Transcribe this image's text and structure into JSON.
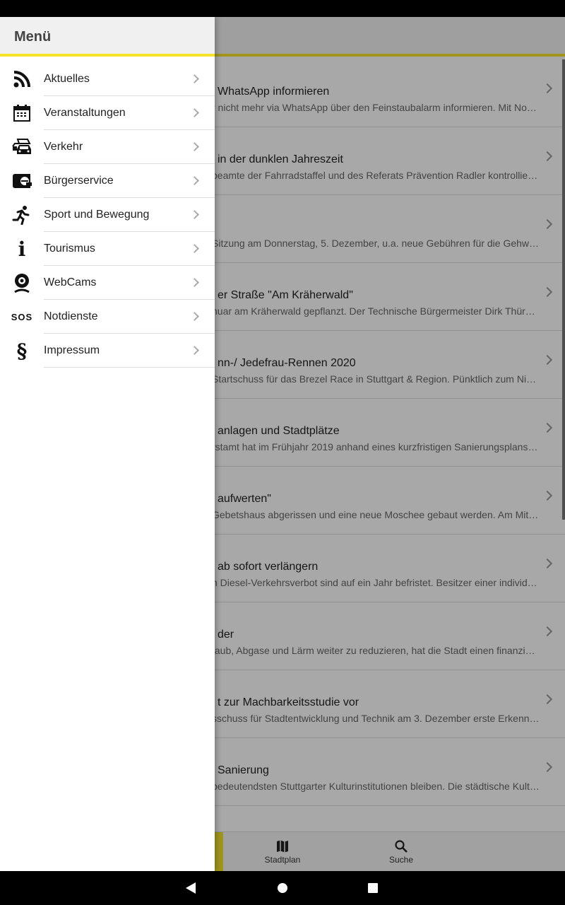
{
  "drawer": {
    "title": "Menü",
    "items": [
      {
        "label": "Aktuelles",
        "icon": "rss-icon"
      },
      {
        "label": "Veranstaltungen",
        "icon": "calendar-icon"
      },
      {
        "label": "Verkehr",
        "icon": "traffic-cars-icon"
      },
      {
        "label": "Bürgerservice",
        "icon": "e-service-icon"
      },
      {
        "label": "Sport und Bewegung",
        "icon": "running-icon"
      },
      {
        "label": "Tourismus",
        "icon": "info-icon",
        "glyph": "i"
      },
      {
        "label": "WebCams",
        "icon": "webcam-icon"
      },
      {
        "label": "Notdienste",
        "icon": "sos-icon",
        "glyph": "SOS"
      },
      {
        "label": "Impressum",
        "icon": "paragraph-icon",
        "glyph": "§"
      }
    ]
  },
  "news": [
    {
      "title": "WhatsApp informieren",
      "desc": "r nicht mehr via WhatsApp über den Feinstaubalarm informieren. Mit No…"
    },
    {
      "title": "in der dunklen Jahreszeit",
      "desc": "beamte der Fahrradstaffel und des Referats Prävention Radler kontrollier…"
    },
    {
      "title": "",
      "desc": "Sitzung am Donnerstag, 5. Dezember, u.a. neue Gebühren für die Gehweg…"
    },
    {
      "title": "er Straße \"Am Kräherwald\"",
      "desc": "nuar am Kräherwald gepflanzt. Der Technische Bürgermeister Dirk Thür…"
    },
    {
      "title": "nn-/ Jedefrau-Rennen 2020",
      "desc": "Startschuss für das Brezel Race in Stuttgart & Region. Pünktlich zum Nik…"
    },
    {
      "title": "anlagen und Stadtplätze",
      "desc": "rstamt hat im Frühjahr 2019 anhand eines kurzfristigen Sanierungsplans …"
    },
    {
      "title": "aufwerten\"",
      "desc": " Gebetshaus abgerissen und eine neue Moschee gebaut werden. Am Mit…"
    },
    {
      "title": "ab sofort verlängern",
      "desc": "n Diesel-Verkehrsverbot sind auf ein Jahr befristet. Besitzer einer individu…"
    },
    {
      "title": "der",
      "desc": "taub, Abgase und Lärm weiter zu reduzieren, hat die Stadt einen finanziel…"
    },
    {
      "title": "t zur Machbarkeitsstudie vor",
      "desc": "sschuss für Stadtentwicklung und Technik am 3. Dezember erste Erkennt…"
    },
    {
      "title": "Sanierung",
      "desc": "bedeutendsten Stuttgarter Kulturinstitutionen bleiben. Die städtische Kult…"
    }
  ],
  "bottom_nav": {
    "tabs": [
      {
        "label": "Stadtplan",
        "icon": "map-icon"
      },
      {
        "label": "Suche",
        "icon": "search-icon"
      }
    ]
  },
  "colors": {
    "accent": "#f5e42a"
  }
}
